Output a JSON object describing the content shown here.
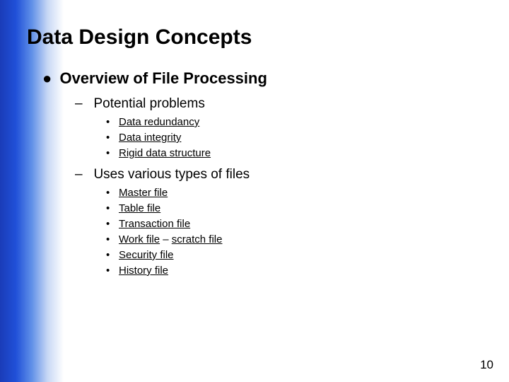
{
  "title": "Data Design Concepts",
  "level1": {
    "label": "Overview of File Processing"
  },
  "section1": {
    "label": "Potential problems",
    "items": [
      "Data redundancy",
      "Data integrity",
      "Rigid data structure"
    ]
  },
  "section2": {
    "label": "Uses various types of files",
    "items": [
      [
        {
          "text": "Master file",
          "u": true
        }
      ],
      [
        {
          "text": "Table file",
          "u": true
        }
      ],
      [
        {
          "text": "Transaction file",
          "u": true
        }
      ],
      [
        {
          "text": "Work file",
          "u": true
        },
        {
          "text": " – ",
          "u": false
        },
        {
          "text": "scratch file",
          "u": true
        }
      ],
      [
        {
          "text": "Security file",
          "u": true
        }
      ],
      [
        {
          "text": "History file",
          "u": true
        }
      ]
    ]
  },
  "pageNumber": "10"
}
